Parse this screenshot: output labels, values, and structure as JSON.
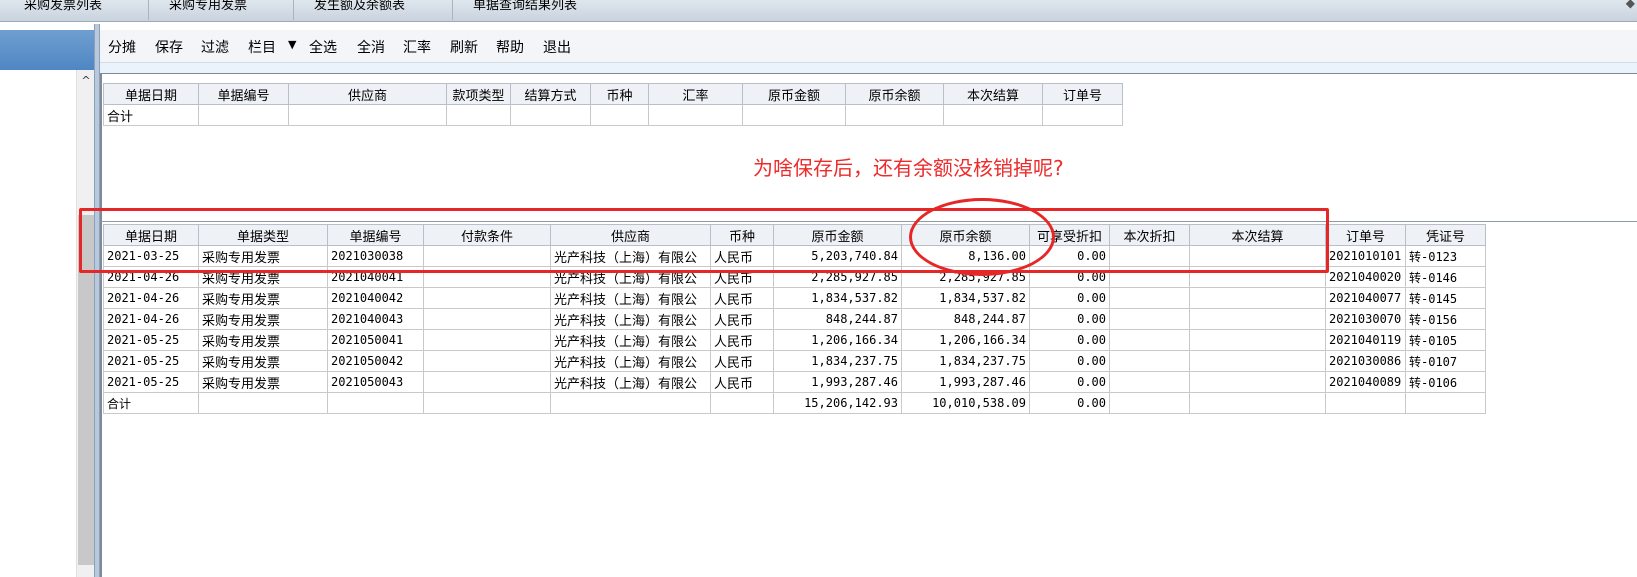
{
  "tabs": [
    "采购发票列表",
    "采购专用发票",
    "发生额及余额表",
    "单据查询结果列表"
  ],
  "toolbar": {
    "buttons": [
      "分摊",
      "保存",
      "过滤",
      "栏目",
      "全选",
      "全消",
      "汇率",
      "刷新",
      "帮助",
      "退出"
    ],
    "dropdown_arrow": "▼"
  },
  "upper_table": {
    "headers": [
      "单据日期",
      "单据编号",
      "供应商",
      "款项类型",
      "结算方式",
      "币种",
      "汇率",
      "原币金额",
      "原币余额",
      "本次结算",
      "订单号"
    ],
    "total_label": "合计"
  },
  "annotation": {
    "text": "为啥保存后，还有余额没核销掉呢?",
    "color": "#e52727"
  },
  "lower_table": {
    "headers": [
      "单据日期",
      "单据类型",
      "单据编号",
      "付款条件",
      "供应商",
      "币种",
      "原币金额",
      "原币余额",
      "可享受折扣",
      "本次折扣",
      "本次结算",
      "订单号",
      "凭证号"
    ],
    "rows": [
      [
        "2021-03-25",
        "采购专用发票",
        "2021030038",
        "",
        "光产科技（上海）有限公",
        "人民币",
        "5,203,740.84",
        "8,136.00",
        "0.00",
        "",
        "",
        "2021010101",
        "转-0123"
      ],
      [
        "2021-04-26",
        "采购专用发票",
        "2021040041",
        "",
        "光产科技（上海）有限公",
        "人民币",
        "2,285,927.85",
        "2,285,927.85",
        "0.00",
        "",
        "",
        "2021040020",
        "转-0146"
      ],
      [
        "2021-04-26",
        "采购专用发票",
        "2021040042",
        "",
        "光产科技（上海）有限公",
        "人民币",
        "1,834,537.82",
        "1,834,537.82",
        "0.00",
        "",
        "",
        "2021040077",
        "转-0145"
      ],
      [
        "2021-04-26",
        "采购专用发票",
        "2021040043",
        "",
        "光产科技（上海）有限公",
        "人民币",
        "848,244.87",
        "848,244.87",
        "0.00",
        "",
        "",
        "2021030070",
        "转-0156"
      ],
      [
        "2021-05-25",
        "采购专用发票",
        "2021050041",
        "",
        "光产科技（上海）有限公",
        "人民币",
        "1,206,166.34",
        "1,206,166.34",
        "0.00",
        "",
        "",
        "2021040119",
        "转-0105"
      ],
      [
        "2021-05-25",
        "采购专用发票",
        "2021050042",
        "",
        "光产科技（上海）有限公",
        "人民币",
        "1,834,237.75",
        "1,834,237.75",
        "0.00",
        "",
        "",
        "2021030086",
        "转-0107"
      ],
      [
        "2021-05-25",
        "采购专用发票",
        "2021050043",
        "",
        "光产科技（上海）有限公",
        "人民币",
        "1,993,287.46",
        "1,993,287.46",
        "0.00",
        "",
        "",
        "2021040089",
        "转-0106"
      ]
    ],
    "total": [
      "合计",
      "",
      "",
      "",
      "",
      "",
      "15,206,142.93",
      "10,010,538.09",
      "0.00",
      "",
      "",
      "",
      ""
    ]
  },
  "icons": {
    "scroll_up": "^",
    "corner": "◆"
  }
}
